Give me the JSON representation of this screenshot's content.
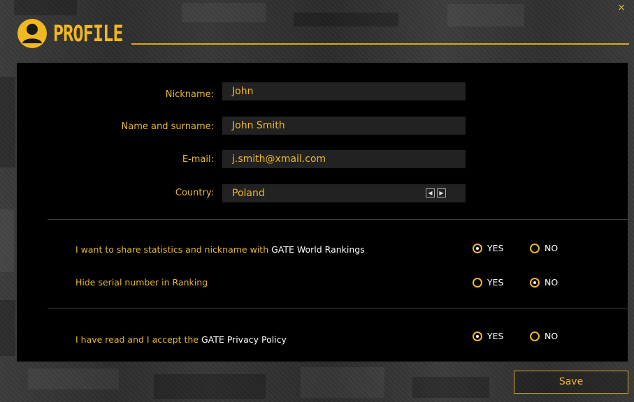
{
  "window": {
    "close_glyph": "×"
  },
  "header": {
    "title": "PROFILE"
  },
  "form": {
    "nickname": {
      "label": "Nickname:",
      "value": "John"
    },
    "name": {
      "label": "Name and surname:",
      "value": "John Smith"
    },
    "email": {
      "label": "E-mail:",
      "value": "j.smith@xmail.com"
    },
    "country": {
      "label": "Country:",
      "value": "Poland",
      "prev_glyph": "◀",
      "next_glyph": "▶"
    }
  },
  "options": [
    {
      "text_pre": "I want to share statistics and nickname with ",
      "text_highlight": "GATE World Rankings",
      "yes_label": "YES",
      "no_label": "NO",
      "selected": "yes"
    },
    {
      "text_pre": "Hide serial number in Ranking",
      "text_highlight": "",
      "yes_label": "YES",
      "no_label": "NO",
      "selected": "no"
    },
    {
      "text_pre": "I have read and I accept the ",
      "text_highlight": "GATE Privacy Policy",
      "yes_label": "YES",
      "no_label": "NO",
      "selected": "yes"
    }
  ],
  "footer": {
    "save_label": "Save"
  },
  "colors": {
    "accent": "#f0b821",
    "panel_bg": "#000000",
    "input_bg": "#222222",
    "highlight_text": "#ffffff"
  }
}
